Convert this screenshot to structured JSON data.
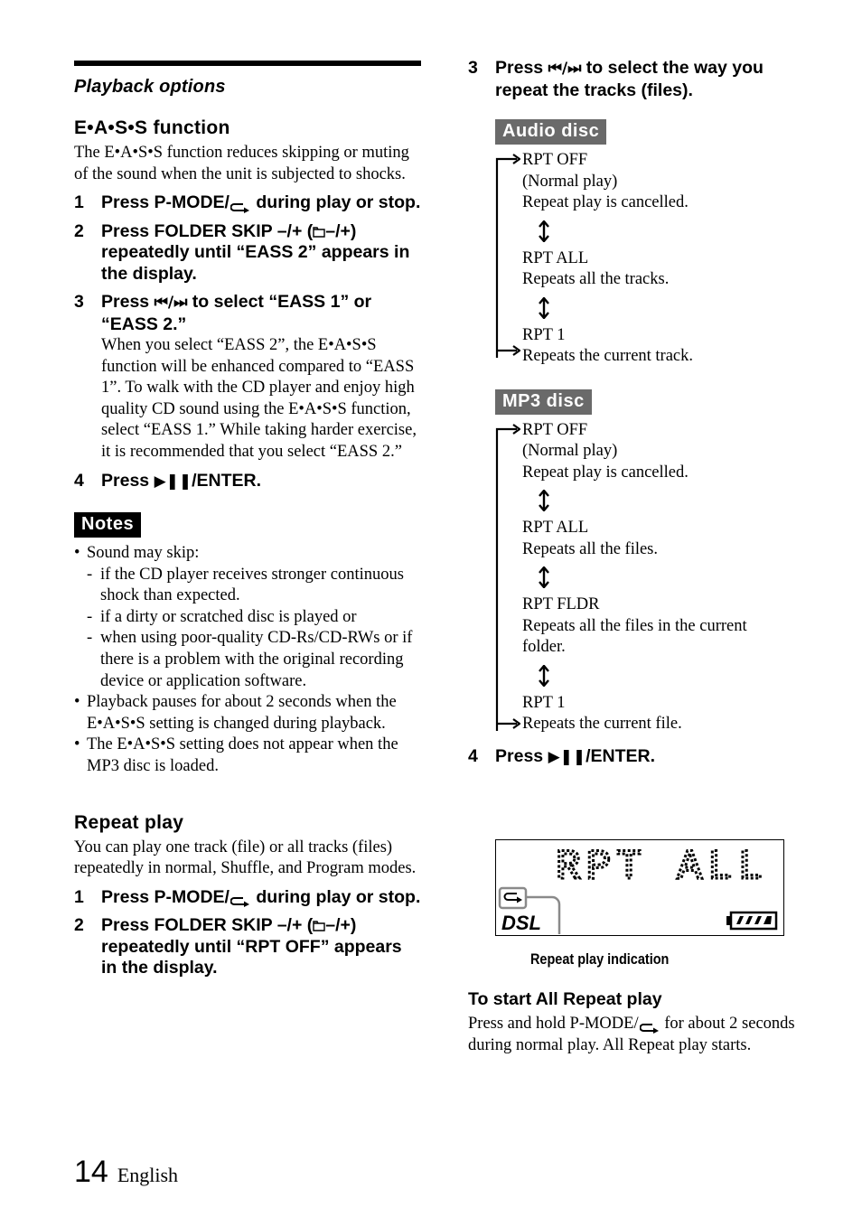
{
  "header": {
    "section": "Playback options"
  },
  "eass": {
    "title": "E•A•S•S function",
    "intro": "The E•A•S•S function reduces skipping or muting of the sound when the unit is subjected to shocks.",
    "steps": [
      {
        "num": "1",
        "pre": "Press P-MODE/",
        "icon": "repeat-icon",
        "post": " during play or stop."
      },
      {
        "num": "2",
        "pre": "Press FOLDER SKIP –/+ (",
        "icon": "folder-icon",
        "post": "–/+) repeatedly until “EASS 2” appears in the display."
      },
      {
        "num": "3",
        "pre": "Press ",
        "icon": "prev-next-icon",
        "post": " to select “EASS 1” or “EASS 2.”",
        "detail": "When you select “EASS 2”, the E•A•S•S function will be enhanced compared to “EASS 1”. To walk with the CD player and enjoy high quality CD sound using the E•A•S•S function, select “EASS 1.” While taking harder exercise, it is recommended that you select “EASS 2.”"
      },
      {
        "num": "4",
        "pre": "Press ",
        "icon": "play-pause-icon",
        "post": "/ENTER."
      }
    ]
  },
  "notes": {
    "label": "Notes",
    "items": [
      {
        "text": "Sound may skip:",
        "subs": [
          "if the CD player receives stronger continuous shock than expected.",
          "if a dirty or scratched disc is played or",
          "when using poor-quality CD-Rs/CD-RWs or if there is a problem with the original recording device or application software."
        ]
      },
      {
        "text": "Playback pauses for about 2 seconds when the E•A•S•S setting is changed during playback.",
        "subs": []
      },
      {
        "text": "The E•A•S•S setting does not appear when the MP3 disc is loaded.",
        "subs": []
      }
    ]
  },
  "repeat": {
    "title": "Repeat play",
    "intro": "You can play one track (file) or all tracks (files) repeatedly in normal, Shuffle, and Program modes.",
    "steps": [
      {
        "num": "1",
        "pre": "Press P-MODE/",
        "icon": "repeat-icon",
        "post": " during play or stop."
      },
      {
        "num": "2",
        "pre": "Press FOLDER SKIP –/+ (",
        "icon": "folder-icon",
        "post": "–/+) repeatedly until “RPT OFF” appears in the display."
      },
      {
        "num": "3",
        "pre": "Press ",
        "icon": "prev-next-icon",
        "post": " to select the way you repeat the tracks (files)."
      },
      {
        "num": "4",
        "pre": "Press ",
        "icon": "play-pause-icon",
        "post": "/ENTER."
      }
    ]
  },
  "audio_disc": {
    "label": "Audio disc",
    "modes": [
      {
        "name": "RPT OFF",
        "lines": [
          "(Normal play)",
          "Repeat play is cancelled."
        ]
      },
      {
        "name": "RPT ALL",
        "lines": [
          "Repeats all the tracks."
        ]
      },
      {
        "name": "RPT 1",
        "lines": [
          "Repeats the current track."
        ]
      }
    ]
  },
  "mp3_disc": {
    "label": "MP3 disc",
    "modes": [
      {
        "name": "RPT OFF",
        "lines": [
          "(Normal play)",
          "Repeat play is cancelled."
        ]
      },
      {
        "name": "RPT ALL",
        "lines": [
          "Repeats all the files."
        ]
      },
      {
        "name": "RPT FLDR",
        "lines": [
          "Repeats all the files in the current",
          "folder."
        ]
      },
      {
        "name": "RPT 1",
        "lines": [
          "Repeats the current file."
        ]
      }
    ]
  },
  "display": {
    "lcd_text": "RPT ALL",
    "dsl_label": "DSL",
    "battery_level": "4/4",
    "caption": "Repeat play indication"
  },
  "all_repeat": {
    "title": "To start All Repeat play",
    "text_pre": "Press and hold P-MODE/",
    "text_post": " for about 2 seconds during normal play. All Repeat play starts."
  },
  "footer": {
    "page_number": "14",
    "language": "English"
  },
  "colors": {
    "text": "#000000",
    "disc_badge_bg": "#6a6a6a",
    "notes_badge_bg": "#000000",
    "callout_line": "#8a8a8a"
  }
}
